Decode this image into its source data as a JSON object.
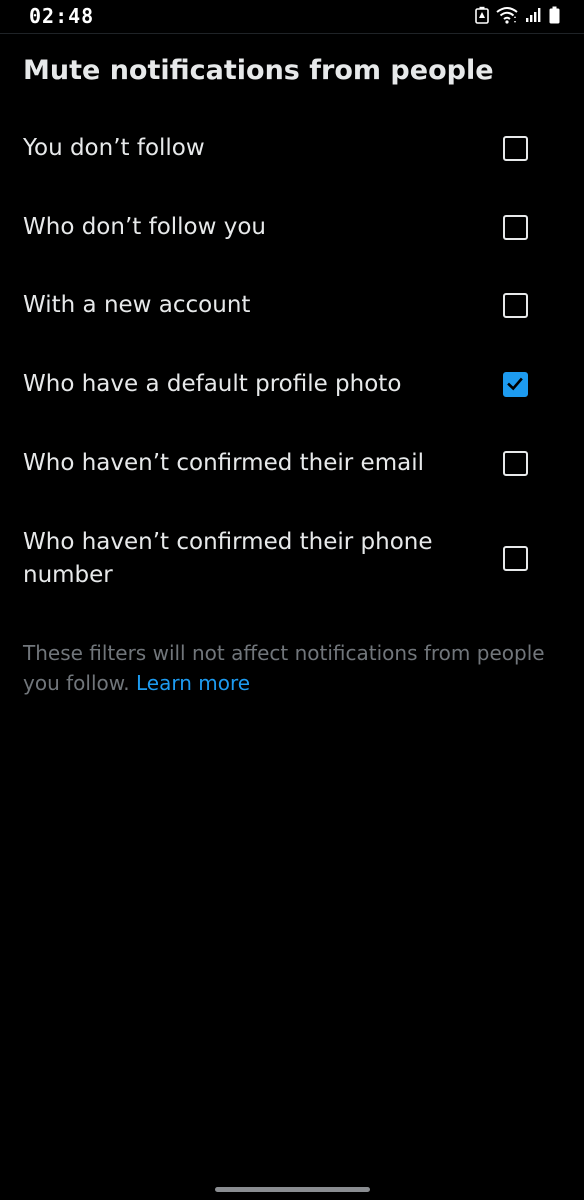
{
  "status_bar": {
    "time": "02:48",
    "icons": [
      "battery-saver-icon",
      "wifi-icon",
      "signal-icon",
      "battery-icon"
    ]
  },
  "page": {
    "title": "Mute notifications from people"
  },
  "options": [
    {
      "label": "You don’t follow",
      "checked": false
    },
    {
      "label": "Who don’t follow you",
      "checked": false
    },
    {
      "label": "With a new account",
      "checked": false
    },
    {
      "label": "Who have a default profile photo",
      "checked": true
    },
    {
      "label": "Who haven’t confirmed their email",
      "checked": false
    },
    {
      "label": "Who haven’t confirmed their phone number",
      "checked": false
    }
  ],
  "footer": {
    "note": "These filters will not affect notifications from people you follow. ",
    "learn_more": "Learn more"
  },
  "colors": {
    "background": "#000000",
    "text": "#e7e9ea",
    "secondary_text": "#71767b",
    "accent": "#1d9bf0"
  }
}
